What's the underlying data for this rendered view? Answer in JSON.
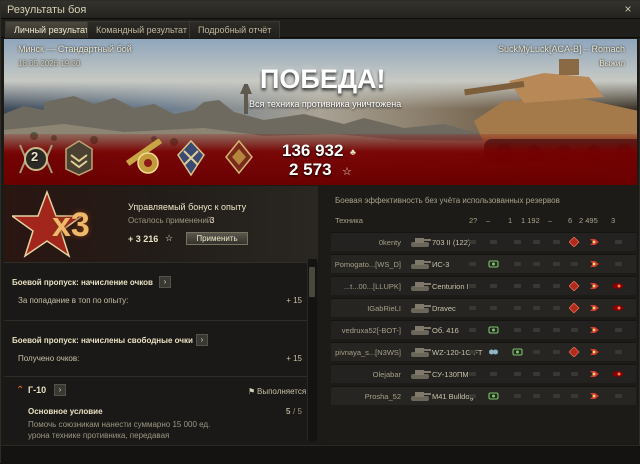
{
  "window": {
    "title": "Результаты боя",
    "close_glyph": "×"
  },
  "tabs": [
    {
      "label": "Личный результат",
      "active": true
    },
    {
      "label": "Командный результат",
      "active": false
    },
    {
      "label": "Подробный отчёт",
      "active": false
    }
  ],
  "banner": {
    "map_mode": "Минск — Стандартный бой",
    "datetime": "18.05.2026 19:30",
    "player": "SuckMyLuck[ACA-B] – Romach",
    "status": "Выжил",
    "victory": "ПОБЕДА!",
    "victory_sub": "Вся техника противника уничтожена",
    "credits": "136 932",
    "experience": "2 573",
    "medal_count": "2"
  },
  "bonus": {
    "multiplier": "x3",
    "title": "Управляемый бонус к опыту",
    "remaining_label": "Осталось применений:",
    "remaining_value": "3",
    "xp_value": "+ 3 216",
    "apply_label": "Применить"
  },
  "sections": [
    {
      "title": "Боевой пропуск: начисление очков",
      "line": "За попадание в топ по опыту:",
      "value": "+ 15"
    },
    {
      "title": "Боевой пропуск: начислены свободные очки",
      "line": "Получено очков:",
      "value": "+ 15"
    }
  ],
  "mission": {
    "name": "Г-10",
    "status": "Выполняется",
    "condition_title": "Основное условие",
    "condition_progress": "5",
    "condition_total": "/ 5",
    "condition_text_1": "Помочь союзникам нанести суммарно 15 000 ед.",
    "condition_text_2": "урона технике противника, передавая"
  },
  "efficiency": {
    "title": "Боевая эффективность без учёта использованных резервов",
    "col_vehicle": "Техника",
    "totals": [
      "2?",
      "–",
      "1",
      "1 192",
      "–",
      "6",
      "2 495",
      "3"
    ],
    "rows": [
      {
        "player": "0kenty",
        "tank": "703 II (122)",
        "icons": [
          "none",
          "none",
          "none",
          "none",
          "none",
          "crit",
          "dmg",
          "none"
        ]
      },
      {
        "player": "Pomogato...[WS_D]",
        "tank": "ИС-3",
        "icons": [
          "none",
          "spot",
          "none",
          "none",
          "none",
          "none",
          "dmg",
          "none"
        ]
      },
      {
        "player": "...t...00...[LLUPK]",
        "tank": "Centurion I",
        "icons": [
          "none",
          "none",
          "none",
          "none",
          "none",
          "crit",
          "dmg",
          "kill"
        ]
      },
      {
        "player": "IGabRieLI",
        "tank": "Dravec",
        "icons": [
          "none",
          "none",
          "none",
          "none",
          "none",
          "crit",
          "dmg",
          "kill"
        ]
      },
      {
        "player": "vedruxa52[-BOT-]",
        "tank": "Об. 416",
        "icons": [
          "none",
          "spot",
          "none",
          "none",
          "none",
          "none",
          "dmg",
          "none"
        ]
      },
      {
        "player": "pivnaya_s...[N3WS]",
        "tank": "WZ-120-1G FT",
        "icons": [
          "none",
          "assist",
          "spot",
          "none",
          "none",
          "crit",
          "dmg",
          "none"
        ]
      },
      {
        "player": "Olejabar",
        "tank": "СУ-130ПМ",
        "icons": [
          "none",
          "none",
          "none",
          "none",
          "none",
          "none",
          "dmg",
          "kill"
        ]
      },
      {
        "player": "Prosha_52",
        "tank": "M41 Bulldog",
        "icons": [
          "none",
          "spot",
          "none",
          "none",
          "none",
          "none",
          "dmg",
          "none"
        ]
      }
    ]
  },
  "colors": {
    "accent_red": "#8a0000",
    "gold": "#e9d9a0",
    "spot_green": "#7cc66b",
    "crit_red": "#d23a2a"
  }
}
